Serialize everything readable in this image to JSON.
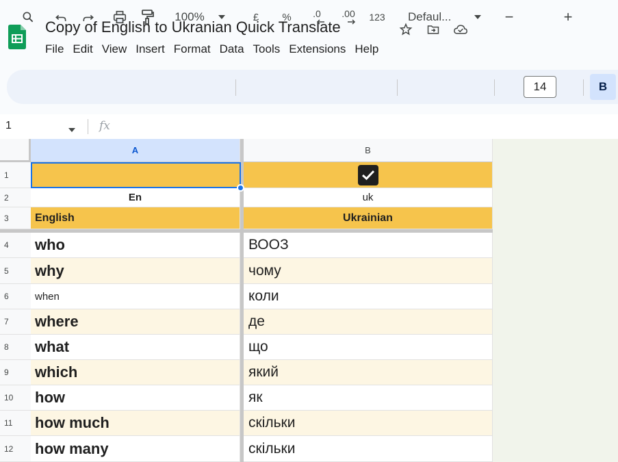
{
  "app": {
    "doc_title": "Copy of English to Ukranian Quick Translate",
    "menu": [
      "File",
      "Edit",
      "View",
      "Insert",
      "Format",
      "Data",
      "Tools",
      "Extensions",
      "Help"
    ]
  },
  "toolbar": {
    "zoom": "100%",
    "currency": "£",
    "percent": "%",
    "decrease_decimal": ".0",
    "increase_decimal": ".00",
    "number_format": "123",
    "font": "Defaul...",
    "minus": "−",
    "font_size": "14",
    "plus": "+",
    "bold": "B"
  },
  "formula_bar": {
    "cell_ref": "1",
    "fx": "fx"
  },
  "columns": [
    "A",
    "B"
  ],
  "rows": [
    {
      "num": "1",
      "a": "",
      "b_checkbox": true,
      "bg": "#f6c44c"
    },
    {
      "num": "2",
      "a": "En",
      "b": "uk",
      "bg": "#ffffff"
    },
    {
      "num": "3",
      "a": "English",
      "b": "Ukrainian",
      "bg": "#f6c44c"
    },
    {
      "num": "4",
      "a": "who",
      "b": "ВООЗ",
      "bg": "#ffffff"
    },
    {
      "num": "5",
      "a": "why",
      "b": "чому",
      "bg": "#fdf6e3"
    },
    {
      "num": "6",
      "a": "when",
      "b": "коли",
      "bg": "#ffffff"
    },
    {
      "num": "7",
      "a": "where",
      "b": "де",
      "bg": "#fdf6e3"
    },
    {
      "num": "8",
      "a": "what",
      "b": "що",
      "bg": "#ffffff"
    },
    {
      "num": "9",
      "a": "which",
      "b": "який",
      "bg": "#fdf6e3"
    },
    {
      "num": "10",
      "a": "how",
      "b": "як",
      "bg": "#ffffff"
    },
    {
      "num": "11",
      "a": "how much",
      "b": "скільки",
      "bg": "#fdf6e3"
    },
    {
      "num": "12",
      "a": "how many",
      "b": "скільки",
      "bg": "#ffffff"
    }
  ],
  "colors": {
    "accent": "#1a73e8",
    "header_yellow": "#f6c44c",
    "band_light": "#fdf6e3",
    "sheets_green": "#0f9d58"
  }
}
